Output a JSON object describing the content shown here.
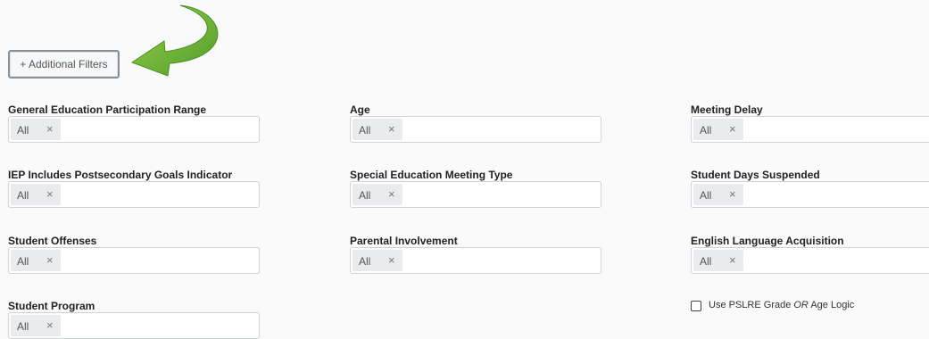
{
  "toolbar": {
    "additional_filters_label": "+ Additional Filters"
  },
  "filters": {
    "gen_ed_participation": {
      "label": "General Education Participation Range",
      "value": "All"
    },
    "age": {
      "label": "Age",
      "value": "All"
    },
    "meeting_delay": {
      "label": "Meeting Delay",
      "value": "All"
    },
    "iep_postsecondary": {
      "label": "IEP Includes Postsecondary Goals Indicator",
      "value": "All"
    },
    "sped_meeting_type": {
      "label": "Special Education Meeting Type",
      "value": "All"
    },
    "days_suspended": {
      "label": "Student Days Suspended",
      "value": "All"
    },
    "student_offenses": {
      "label": "Student Offenses",
      "value": "All"
    },
    "parental_involvement": {
      "label": "Parental Involvement",
      "value": "All"
    },
    "english_acquisition": {
      "label": "English Language Acquisition",
      "value": "All"
    },
    "student_program": {
      "label": "Student Program",
      "value": "All"
    }
  },
  "tag_remove_glyph": "×",
  "pslre_option": {
    "text_before": "Use PSLRE Grade ",
    "text_em": "OR",
    "text_after": " Age Logic",
    "checked": false
  },
  "colors": {
    "arrow": "#6cb33f"
  }
}
